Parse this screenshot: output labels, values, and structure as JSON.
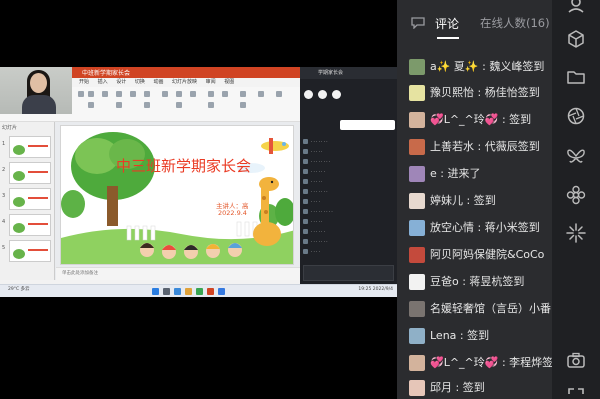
{
  "panel": {
    "tabs": [
      {
        "label": "评论"
      },
      {
        "label": "在线人数(16)"
      }
    ],
    "comments": [
      {
        "text": "a✨ 夏✨ : 魏义峰签到",
        "avatar_color": "#7c9a6b"
      },
      {
        "text": "豫贝熙怡 : 杨佳怡签到",
        "avatar_color": "#e6e3a1"
      },
      {
        "text": "💞L^_^玲💞 : 签到",
        "avatar_color": "#d3b39c"
      },
      {
        "text": "上善若水 : 代薇辰签到",
        "avatar_color": "#c86a4a"
      },
      {
        "text": "e : 进来了",
        "avatar_color": "#9f86b8"
      },
      {
        "text": "婷妹儿 : 签到",
        "avatar_color": "#e7d9cf"
      },
      {
        "text": "放空心情 : 蒋小米签到",
        "avatar_color": "#86b0d6"
      },
      {
        "text": "阿贝阿妈保健院&CoCo",
        "avatar_color": "#c44a3c"
      },
      {
        "text": "豆爸o : 蒋昱杭签到",
        "avatar_color": "#f2f2f2"
      },
      {
        "text": "名媛轻奢馆（言岳）小番",
        "avatar_color": "#7a7470"
      },
      {
        "text": "Lena : 签到",
        "avatar_color": "#8fb0c7"
      },
      {
        "text": "💞L^_^玲💞 : 李程烨签",
        "avatar_color": "#d3b39c"
      },
      {
        "text": "邱月 : 签到",
        "avatar_color": "#e6c6b8"
      }
    ]
  },
  "screen": {
    "ppt_title": "中班新学期家长会",
    "ppt_menu": [
      "开始",
      "插入",
      "设计",
      "切换",
      "动画",
      "幻灯片放映",
      "审阅",
      "视图",
      "开发工具",
      "会员专享"
    ],
    "slide_title": "中三班新学期家长会",
    "speaker": "主讲人：高",
    "date": "2022.9.4",
    "notes": "单击此处添加备注",
    "thumb_label": "幻灯片",
    "meeting_title": "学期家长会",
    "taskbar_weather": "29°C 多云",
    "taskbar_clock": "19:25 2022/9/4"
  },
  "rail": {
    "icons": [
      "user-icon",
      "cube-icon",
      "folder-icon",
      "aperture-icon",
      "butterfly-icon",
      "flower-icon",
      "sparkle-icon",
      "camera-icon",
      "expand-icon"
    ]
  },
  "colors": {
    "panel_bg": "#2b2c2f",
    "rail_bg": "#1f2023",
    "slide_title": "#ea3b24",
    "ppt_red": "#d04423"
  }
}
